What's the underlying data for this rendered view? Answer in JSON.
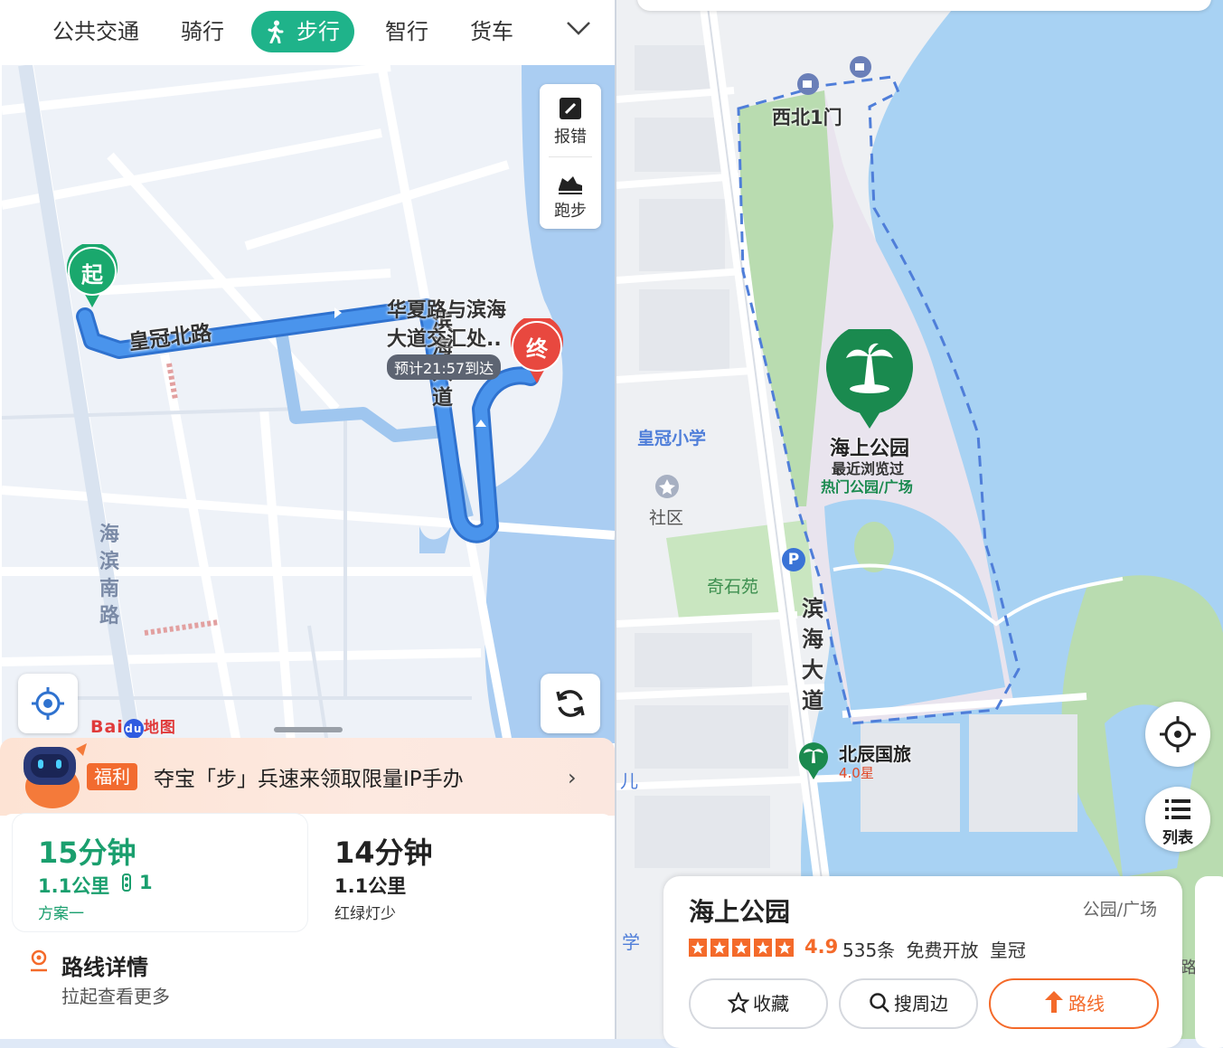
{
  "tabs": [
    {
      "label": "公共交通"
    },
    {
      "label": "骑行"
    },
    {
      "label": "步行",
      "active": true
    },
    {
      "label": "智行"
    },
    {
      "label": "货车"
    }
  ],
  "left_map": {
    "tools": {
      "report_label": "报错",
      "run_label": "跑步"
    },
    "start_marker": "起",
    "end_marker": "终",
    "roads": {
      "north": "皇冠北路",
      "coastal": "滨海大道",
      "south": "海滨南路"
    },
    "destination_label": "华夏路与滨海大道交汇处..",
    "eta_badge": "预计21:57到达",
    "logo_text": "Bai",
    "logo_du": "du",
    "logo_zh": "地图"
  },
  "promo": {
    "tag": "福利",
    "text": "夺宝「步」兵速来领取限量IP手办"
  },
  "options": [
    {
      "time": "15分钟",
      "distance": "1.1公里",
      "lights": "1",
      "note": "方案一",
      "color": "#1a9f6e"
    },
    {
      "time": "14分钟",
      "distance": "1.1公里",
      "note": "红绿灯少",
      "color": "#222222"
    }
  ],
  "route_detail": {
    "title": "路线详情",
    "subtitle": "拉起查看更多"
  },
  "right_map": {
    "gate": "西北1门",
    "park_pin": {
      "name": "海上公园",
      "line1": "最近浏览过",
      "line2": "热门公园/广场"
    },
    "school": "皇冠小学",
    "community": "社区",
    "garden": "奇石苑",
    "parking": "P",
    "road": "滨海大道",
    "hotel": {
      "name": "北辰国旅",
      "rating": "4.0星"
    },
    "edge_labels": {
      "left_char": "儿",
      "left_school_char": "学",
      "right_char": "路"
    },
    "list_label": "列表"
  },
  "poi": {
    "name": "海上公园",
    "category": "公园/广场",
    "rating": "4.9",
    "reviews": "535条",
    "fee": "免费开放",
    "area": "皇冠",
    "buttons": {
      "favorite": "收藏",
      "nearby": "搜周边",
      "route": "路线"
    }
  },
  "colors": {
    "accent": "#1fb38a",
    "route_blue": "#3b82e6",
    "orange": "#f46a2a",
    "park_green": "#1a8a4f"
  },
  "icons": [
    "walk-icon",
    "chevron-down-icon",
    "edit-icon",
    "running-shoe-icon",
    "locate-icon",
    "refresh-icon",
    "robot-mascot-icon",
    "location-pin-icon",
    "palm-tree-icon",
    "star-icon",
    "search-icon",
    "route-arrow-icon",
    "crosshair-icon",
    "list-icon",
    "parking-icon"
  ]
}
